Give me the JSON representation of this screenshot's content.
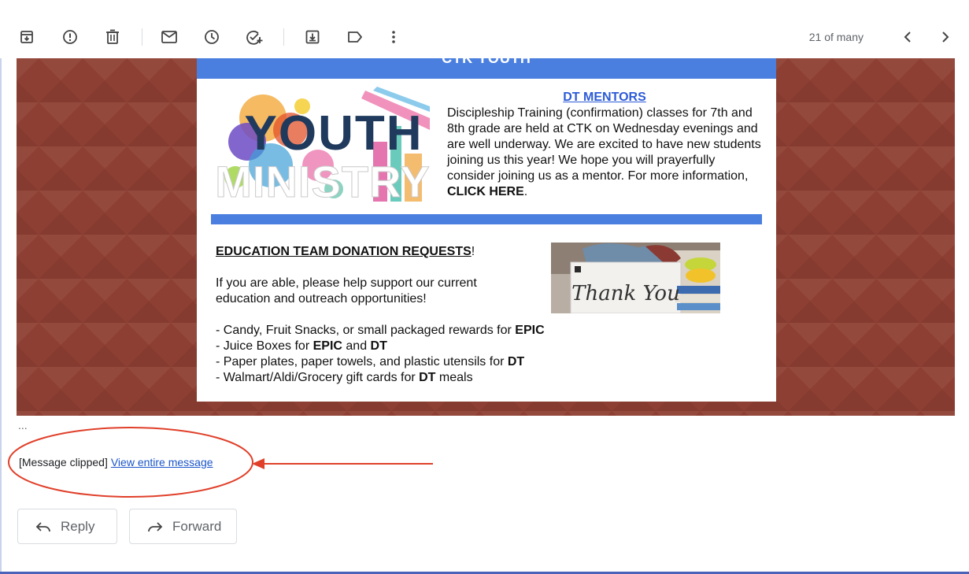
{
  "toolbar": {
    "icons": [
      "archive-icon",
      "report-spam-icon",
      "delete-icon",
      "mark-unread-icon",
      "snooze-icon",
      "add-task-icon",
      "move-to-icon",
      "label-icon",
      "more-icon"
    ],
    "pager_text": "21 of many"
  },
  "email": {
    "header_text": "CTK YOUTH",
    "youth_image_text_top": "YOUTH",
    "youth_image_text_bottom": "MINISTRY",
    "mentors_title": "DT MENTORS",
    "mentors_body": "Discipleship Training (confirmation) classes for 7th and 8th grade are held at CTK on Wednesday evenings and are well underway. We are excited to have new students joining us this year! We hope you will prayerfully consider joining us as a mentor. For more information, ",
    "mentors_link": "CLICK HERE",
    "mentors_end": ".",
    "edu_title": "EDUCATION TEAM DONATION REQUESTS",
    "edu_title_suffix": "!",
    "edu_intro": "If you are able, please help support our current education and outreach opportunities!",
    "thanks_image_text": "Thank You",
    "list": [
      {
        "text": "- Candy, Fruit Snacks, or small packaged rewards for ",
        "bold": "EPIC",
        "after": "",
        "bold2": "",
        "after2": ""
      },
      {
        "text": "- Juice Boxes for ",
        "bold": "EPIC",
        "after": " and ",
        "bold2": "DT",
        "after2": ""
      },
      {
        "text": "- Paper plates, paper towels, and plastic utensils for ",
        "bold": "DT",
        "after": "",
        "bold2": "",
        "after2": ""
      },
      {
        "text": "- Walmart/Aldi/Grocery gift cards for ",
        "bold": "DT",
        "after": " meals",
        "bold2": "",
        "after2": ""
      }
    ]
  },
  "footer": {
    "ellipsis": "...",
    "clipped_label": "[Message clipped]",
    "view_entire_link": "View entire message",
    "reply_label": "Reply",
    "forward_label": "Forward"
  },
  "colors": {
    "banner": "#8e3f33",
    "card_accent": "#4a7fe0",
    "link": "#1a55c9",
    "annotation": "#e0402a"
  }
}
